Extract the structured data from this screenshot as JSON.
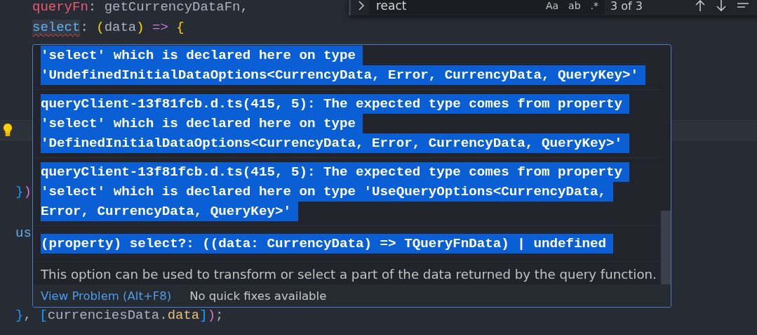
{
  "find": {
    "query": "react",
    "toggles": [
      {
        "label": "Aa",
        "selected": false
      },
      {
        "label": "ab",
        "selected": false
      },
      {
        "label": ".*",
        "selected": false
      }
    ],
    "match_count": "3 of 3"
  },
  "editor": {
    "lines": [
      {
        "kind": "code",
        "indented": true,
        "current": false,
        "lightbulb": false,
        "tokens": [
          {
            "text": "queryFn",
            "kind": "property"
          },
          {
            "text": ": getCurrencyDataFn,",
            "kind": "plain"
          }
        ]
      },
      {
        "kind": "code",
        "indented": true,
        "current": false,
        "lightbulb": false,
        "tokens": [
          {
            "text": "select",
            "kind": "error"
          },
          {
            "text": ": ",
            "kind": "plain"
          },
          {
            "text": "(",
            "kind": "bracket_gold"
          },
          {
            "text": "data",
            "kind": "plain"
          },
          {
            "text": ") ",
            "kind": "bracket_gold"
          },
          {
            "text": "=> ",
            "kind": "operator"
          },
          {
            "text": "{",
            "kind": "bracket_gold"
          }
        ]
      },
      {
        "kind": "blank",
        "current": false,
        "lightbulb": false
      },
      {
        "kind": "blank",
        "current": false,
        "lightbulb": false
      },
      {
        "kind": "blank",
        "current": false,
        "lightbulb": false
      },
      {
        "kind": "blank",
        "current": false,
        "lightbulb": false
      },
      {
        "kind": "blank",
        "current": true,
        "lightbulb": true
      },
      {
        "kind": "blank",
        "current": false,
        "lightbulb": false
      },
      {
        "kind": "blank",
        "current": false,
        "lightbulb": false
      },
      {
        "kind": "code",
        "indented": false,
        "current": false,
        "lightbulb": false,
        "tokens": [
          {
            "text": "}",
            "kind": "bracket_blue"
          },
          {
            "text": ")",
            "kind": "bracket_pink"
          }
        ]
      },
      {
        "kind": "blank",
        "current": false,
        "lightbulb": false
      },
      {
        "kind": "code",
        "indented": false,
        "current": false,
        "lightbulb": false,
        "tokens": [
          {
            "text": "us",
            "kind": "function"
          }
        ]
      },
      {
        "kind": "blank",
        "current": false,
        "lightbulb": false
      },
      {
        "kind": "blank",
        "current": false,
        "lightbulb": false
      },
      {
        "kind": "blank",
        "current": false,
        "lightbulb": false
      },
      {
        "kind": "code",
        "indented": false,
        "current": false,
        "lightbulb": false,
        "tokens": [
          {
            "text": "}",
            "kind": "bracket_blue"
          },
          {
            "text": ", ",
            "kind": "plain"
          },
          {
            "text": "[",
            "kind": "bracket_blue"
          },
          {
            "text": "currenciesData.",
            "kind": "plain"
          },
          {
            "text": "data",
            "kind": "member"
          },
          {
            "text": "]",
            "kind": "bracket_blue"
          },
          {
            "text": ")",
            "kind": "bracket_pink"
          },
          {
            "text": ";",
            "kind": "plain"
          }
        ]
      }
    ]
  },
  "hover": {
    "messages": [
      {
        "lines": [
          "'select' which is declared here on type",
          "'UndefinedInitialDataOptions<CurrencyData, Error, CurrencyData, QueryKey>'"
        ]
      },
      {
        "lines": [
          "queryClient-13f81fcb.d.ts(415, 5): The expected type comes from property",
          "'select' which is declared here on type",
          "'DefinedInitialDataOptions<CurrencyData, Error, CurrencyData, QueryKey>'"
        ]
      },
      {
        "lines": [
          "queryClient-13f81fcb.d.ts(415, 5): The expected type comes from property",
          "'select' which is declared here on type 'UseQueryOptions<CurrencyData,",
          "Error, CurrencyData, QueryKey>'"
        ]
      }
    ],
    "signature": "(property) select?: ((data: CurrencyData) => TQueryFnData) | undefined",
    "documentation": "This option can be used to transform or select a part of the data returned by the query function.",
    "view_problem": "View Problem (Alt+F8)",
    "quick_fixes": "No quick fixes available"
  }
}
